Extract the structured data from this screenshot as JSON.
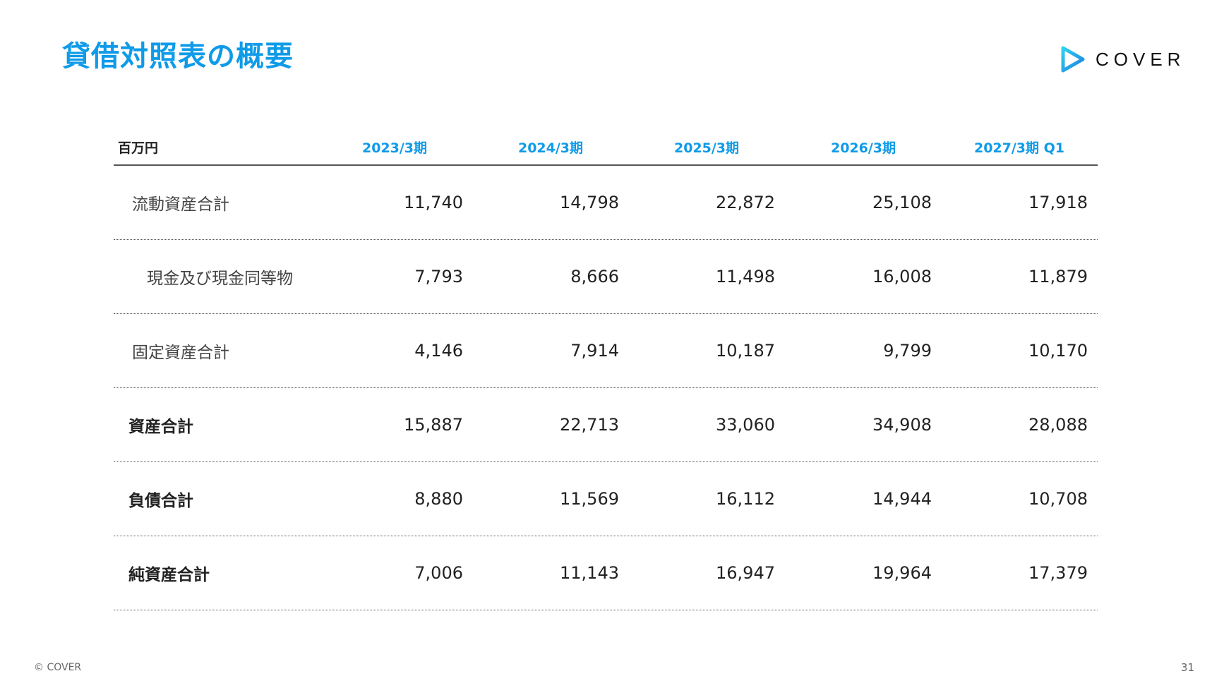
{
  "header": {
    "title": "貸借対照表の概要",
    "logo_text": "COVER",
    "logo_icon": "cover-play-icon",
    "accent_color": "#0f9be8"
  },
  "table": {
    "unit_label": "百万円",
    "periods": [
      "2023/3期",
      "2024/3期",
      "2025/3期",
      "2026/3期",
      "2027/3期 Q1"
    ],
    "rows": [
      {
        "label": "流動資産合計",
        "values": [
          "11,740",
          "14,798",
          "22,872",
          "25,108",
          "17,918"
        ]
      },
      {
        "label": "現金及び現金同等物",
        "values": [
          "7,793",
          "8,666",
          "11,498",
          "16,008",
          "11,879"
        ]
      },
      {
        "label": "固定資産合計",
        "values": [
          "4,146",
          "7,914",
          "10,187",
          "9,799",
          "10,170"
        ]
      },
      {
        "label": "資産合計",
        "values": [
          "15,887",
          "22,713",
          "33,060",
          "34,908",
          "28,088"
        ]
      },
      {
        "label": "負債合計",
        "values": [
          "8,880",
          "11,569",
          "16,112",
          "14,944",
          "10,708"
        ]
      },
      {
        "label": "純資産合計",
        "values": [
          "7,006",
          "11,143",
          "16,947",
          "19,964",
          "17,379"
        ]
      }
    ]
  },
  "footer": {
    "copyright": "© COVER",
    "page_number": "31"
  }
}
